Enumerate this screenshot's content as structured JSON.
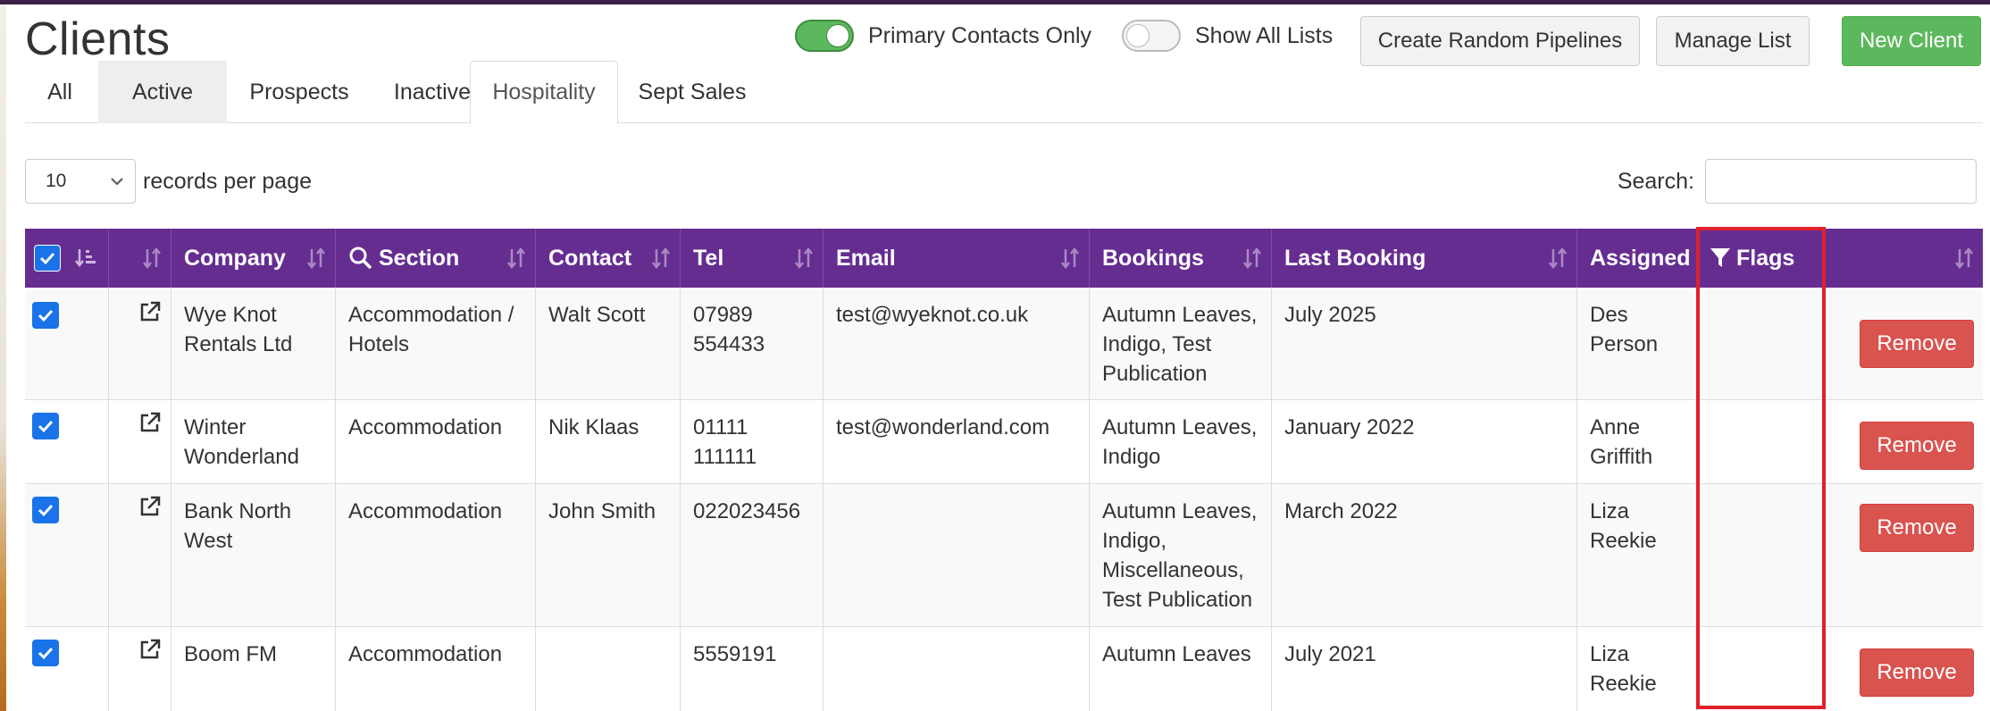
{
  "page": {
    "title": "Clients",
    "toggles": [
      {
        "label": "Primary Contacts Only",
        "on": true
      },
      {
        "label": "Show All Lists",
        "on": false
      }
    ],
    "buttons": {
      "create_pipelines": "Create Random Pipelines",
      "manage_list": "Manage List",
      "new_client": "New Client"
    }
  },
  "tabs": [
    {
      "label": "All",
      "state": "normal"
    },
    {
      "label": "Active",
      "state": "hover"
    },
    {
      "label": "Prospects",
      "state": "normal"
    },
    {
      "label": "Inactive",
      "state": "normal"
    },
    {
      "label": "Hospitality",
      "state": "active"
    },
    {
      "label": "Sept Sales",
      "state": "normal"
    }
  ],
  "length": {
    "value": "10",
    "label": "records per page"
  },
  "search": {
    "label": "Search:",
    "value": ""
  },
  "table": {
    "columns": {
      "company": "Company",
      "section": "Section",
      "contact": "Contact",
      "tel": "Tel",
      "email": "Email",
      "bookings": "Bookings",
      "last_booking": "Last Booking",
      "assigned": "Assigned",
      "flags": "Flags"
    },
    "rows": [
      {
        "checked": true,
        "company": "Wye Knot Rentals Ltd",
        "section": "Accommodation / Hotels",
        "contact": "Walt Scott",
        "tel": "07989 554433",
        "email": "test@wyeknot.co.uk",
        "bookings": "Autumn Leaves, Indigo, Test Publication",
        "last_booking": "July 2025",
        "assigned": "Des Person",
        "flags": "",
        "action": "Remove"
      },
      {
        "checked": true,
        "company": "Winter Wonderland",
        "section": "Accommodation",
        "contact": "Nik Klaas",
        "tel": "01111 111111",
        "email": "test@wonderland.com",
        "bookings": "Autumn Leaves, Indigo",
        "last_booking": "January 2022",
        "assigned": "Anne Griffith",
        "flags": "",
        "action": "Remove"
      },
      {
        "checked": true,
        "company": "Bank North West",
        "section": "Accommodation",
        "contact": "John Smith",
        "tel": "022023456",
        "email": "",
        "bookings": "Autumn Leaves, Indigo, Miscellaneous, Test Publication",
        "last_booking": "March 2022",
        "assigned": "Liza Reekie",
        "flags": "",
        "action": "Remove"
      },
      {
        "checked": true,
        "company": "Boom FM",
        "section": "Accommodation",
        "contact": "",
        "tel": "5559191",
        "email": "",
        "bookings": "Autumn Leaves",
        "last_booking": "July 2021",
        "assigned": "Liza Reekie",
        "flags": "",
        "action": "Remove"
      }
    ]
  },
  "colors": {
    "header_bg": "#662d91",
    "success": "#5cb85c",
    "danger": "#d9534f",
    "checkbox": "#1a73e8",
    "highlight": "#e0202a"
  }
}
